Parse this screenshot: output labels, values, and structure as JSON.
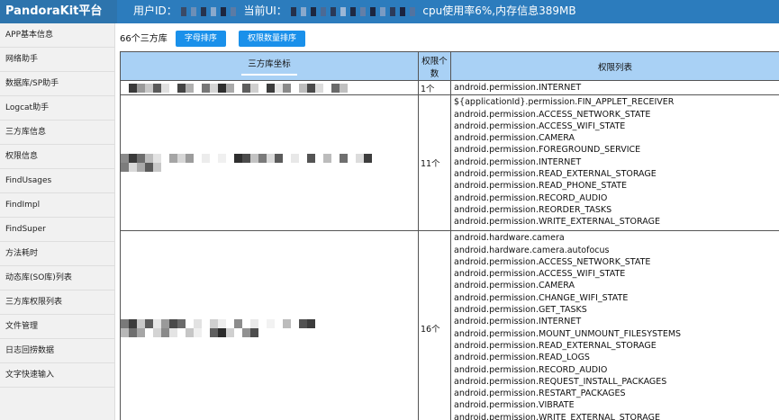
{
  "app": {
    "title": "PandoraKit平台"
  },
  "header": {
    "user_id_label": "用户ID：",
    "current_ui_label": "当前UI：",
    "stats": "cpu使用率6%,内存信息389MB"
  },
  "sidebar": {
    "items": [
      "APP基本信息",
      "网络助手",
      "数据库/SP助手",
      "Logcat助手",
      "三方库信息",
      "权限信息",
      "FindUsages",
      "FindImpl",
      "FindSuper",
      "方法耗时",
      "动态库(SO库)列表",
      "三方库权限列表",
      "文件管理",
      "日志回捞数据",
      "文字快速输入"
    ]
  },
  "toolbar": {
    "count_text": "66个三方库",
    "sort_alpha_label": "字母排序",
    "sort_perm_label": "权限数量排序"
  },
  "table": {
    "headers": {
      "coord": "三方库坐标",
      "count_line1": "权限个",
      "count_line2": "数",
      "list": "权限列表"
    },
    "rows": [
      {
        "count": "1个",
        "permissions": [
          "android.permission.INTERNET"
        ]
      },
      {
        "count": "11个",
        "permissions": [
          "${applicationId}.permission.FIN_APPLET_RECEIVER",
          "android.permission.ACCESS_NETWORK_STATE",
          "android.permission.ACCESS_WIFI_STATE",
          "android.permission.CAMERA",
          "android.permission.FOREGROUND_SERVICE",
          "android.permission.INTERNET",
          "android.permission.READ_EXTERNAL_STORAGE",
          "android.permission.READ_PHONE_STATE",
          "android.permission.RECORD_AUDIO",
          "android.permission.REORDER_TASKS",
          "android.permission.WRITE_EXTERNAL_STORAGE"
        ]
      },
      {
        "count": "16个",
        "permissions": [
          "android.hardware.camera",
          "android.hardware.camera.autofocus",
          "android.permission.ACCESS_NETWORK_STATE",
          "android.permission.ACCESS_WIFI_STATE",
          "android.permission.CAMERA",
          "android.permission.CHANGE_WIFI_STATE",
          "android.permission.GET_TASKS",
          "android.permission.INTERNET",
          "android.permission.MOUNT_UNMOUNT_FILESYSTEMS",
          "android.permission.READ_EXTERNAL_STORAGE",
          "android.permission.READ_LOGS",
          "android.permission.RECORD_AUDIO",
          "android.permission.REQUEST_INSTALL_PACKAGES",
          "android.permission.RESTART_PACKAGES",
          "android.permission.VIBRATE",
          "android.permission.WRITE_EXTERNAL_STORAGE"
        ]
      }
    ]
  },
  "colors": {
    "header": "#2c7cbd",
    "brand": "#2d74ad",
    "button": "#1a90ea",
    "table_header": "#a9d1f5",
    "sidebar": "#f1f1f1"
  },
  "icons": {
    "masked_text": "pixelated-redaction"
  }
}
